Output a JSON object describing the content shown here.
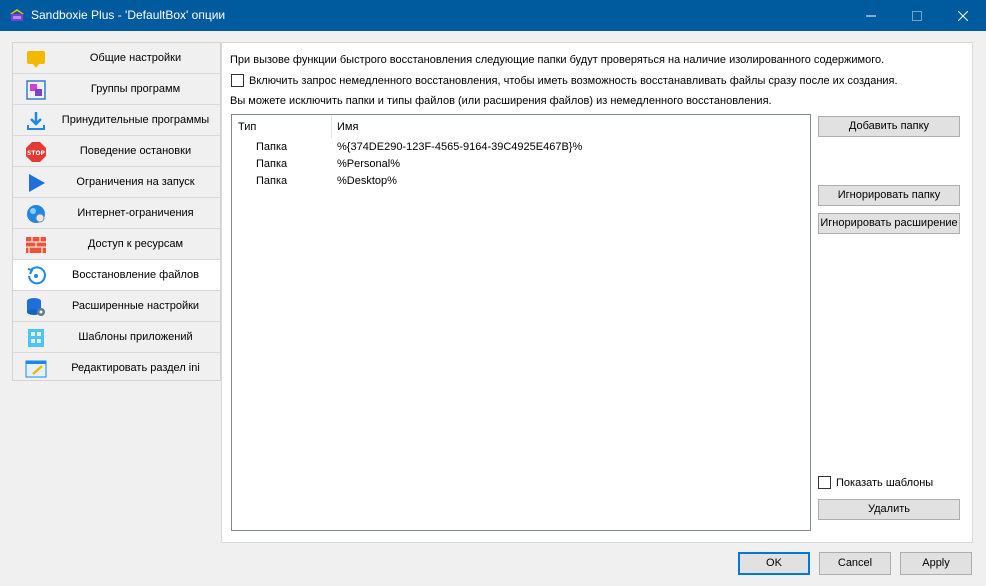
{
  "window": {
    "title": "Sandboxie Plus - 'DefaultBox' опции",
    "minimize": "—",
    "maximize": "☐",
    "close": "✕"
  },
  "nav": {
    "items": [
      {
        "label": "Общие настройки",
        "icon": "general-settings-icon"
      },
      {
        "label": "Группы программ",
        "icon": "program-groups-icon"
      },
      {
        "label": "Принудительные программы",
        "icon": "forced-programs-icon"
      },
      {
        "label": "Поведение остановки",
        "icon": "stop-icon"
      },
      {
        "label": "Ограничения на запуск",
        "icon": "play-icon"
      },
      {
        "label": "Интернет-ограничения",
        "icon": "globe-icon"
      },
      {
        "label": "Доступ к ресурсам",
        "icon": "brick-wall-icon"
      },
      {
        "label": "Восстановление файлов",
        "icon": "recovery-icon",
        "active": true
      },
      {
        "label": "Расширенные настройки",
        "icon": "advanced-settings-icon"
      },
      {
        "label": "Шаблоны приложений",
        "icon": "templates-icon"
      },
      {
        "label": "Редактировать раздел ini",
        "icon": "edit-ini-icon"
      }
    ]
  },
  "recovery": {
    "description": "При вызове функции быстрого восстановления следующие папки будут проверяться на наличие изолированного содержимого.",
    "instant_checkbox_label": "Включить запрос немедленного восстановления, чтобы иметь возможность восстанавливать файлы сразу после их создания.",
    "exclude_description": "Вы можете исключить папки и типы файлов (или расширения файлов) из немедленного восстановления.",
    "list": {
      "headers": {
        "type": "Тип",
        "name": "Имя"
      },
      "rows": [
        {
          "type": "Папка",
          "name": "%{374DE290-123F-4565-9164-39C4925E467B}%"
        },
        {
          "type": "Папка",
          "name": "%Personal%"
        },
        {
          "type": "Папка",
          "name": "%Desktop%"
        }
      ]
    },
    "buttons": {
      "add_folder": "Добавить папку",
      "ignore_folder": "Игнорировать папку",
      "ignore_extension": "Игнорировать расширение",
      "remove": "Удалить"
    },
    "show_templates_label": "Показать шаблоны"
  },
  "dialog_buttons": {
    "ok": "OK",
    "cancel": "Cancel",
    "apply": "Apply"
  },
  "colors": {
    "titlebar": "#005a9e",
    "accent": "#0078d7"
  }
}
